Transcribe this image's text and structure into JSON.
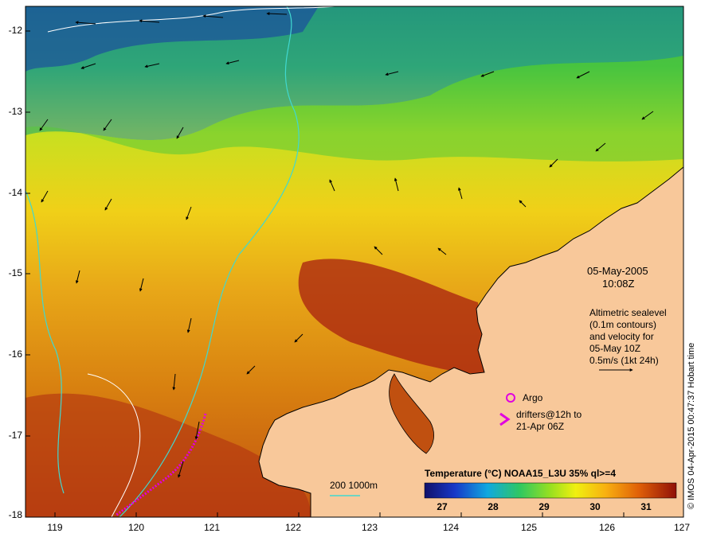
{
  "axes": {
    "y_ticks": [
      "-12",
      "-13",
      "-14",
      "-15",
      "-16",
      "-17",
      "-18"
    ],
    "x_ticks": [
      "119",
      "120",
      "121",
      "122",
      "123",
      "124",
      "125",
      "126",
      "127"
    ]
  },
  "annotations": {
    "date": "05-May-2005",
    "time": "10:08Z",
    "altimetry_line1": "Altimetric sealevel",
    "altimetry_line2": "(0.1m contours)",
    "altimetry_line3": "and velocity for",
    "altimetry_line4": "05-May 10Z",
    "velocity_scale": "0.5m/s (1kt 24h)",
    "argo_label": "Argo",
    "drifters_line1": "drifters@12h to",
    "drifters_line2": "21-Apr 06Z",
    "bathymetry_label": "200  1000m"
  },
  "colorbar": {
    "title": "Temperature (°C) NOAA15_L3U 35% ql>=4",
    "ticks": [
      "27",
      "28",
      "29",
      "30",
      "31"
    ]
  },
  "credit": "© IMOS 04-Apr-2015 00:47:37 Hobart time",
  "colors": {
    "land": "#f8c89a",
    "warm": "#a01808",
    "mid": "#e8a010",
    "cool": "#30c040",
    "cold": "#1838a8",
    "bathy": "#40d8d0",
    "argo": "#e000e0"
  }
}
